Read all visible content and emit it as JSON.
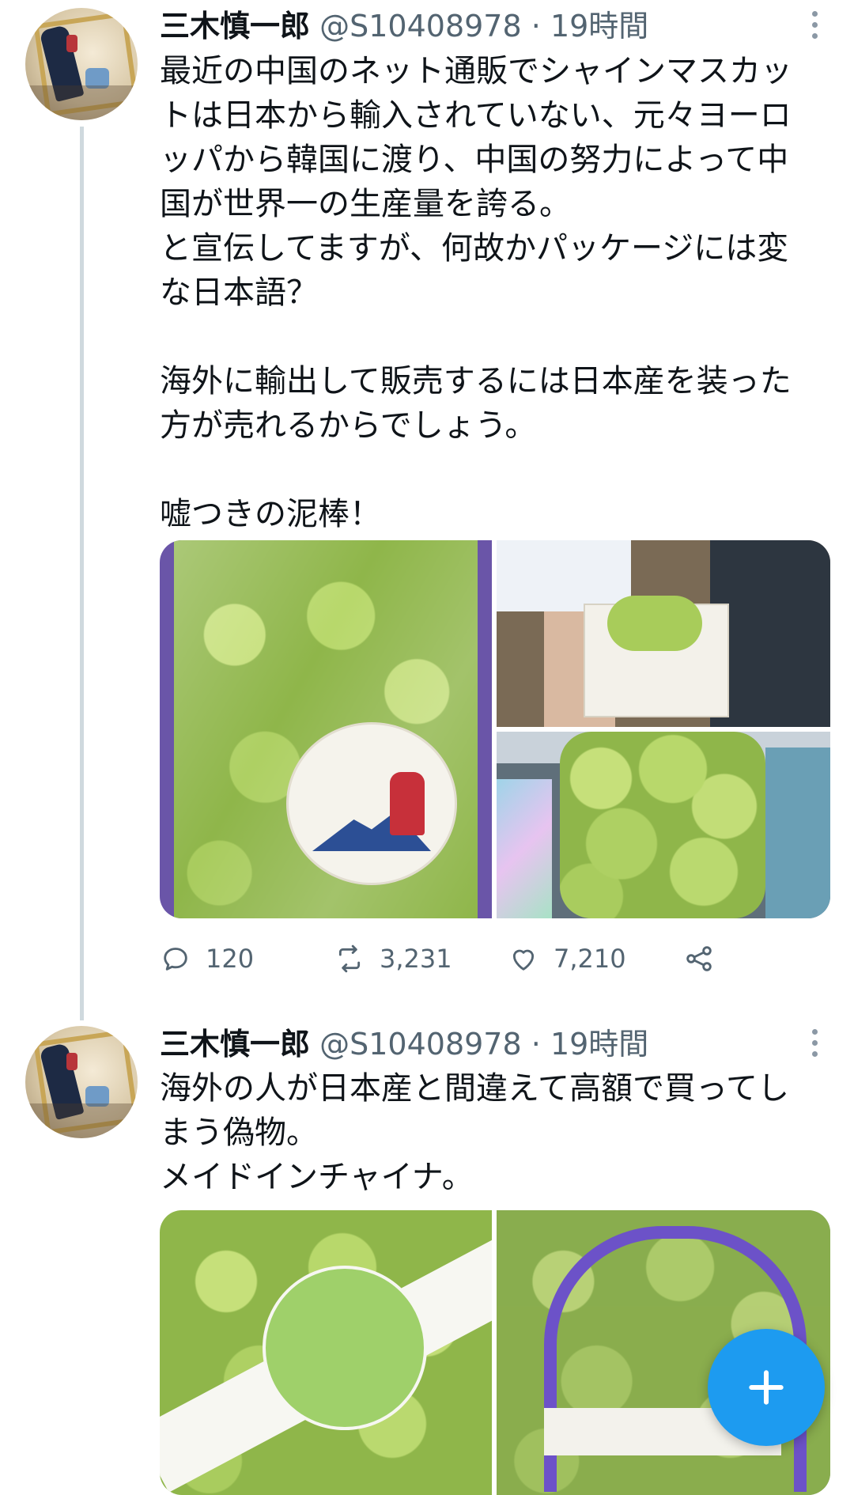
{
  "tweets": [
    {
      "author_name": "三木慎一郎",
      "handle": "@S10408978",
      "separator": "·",
      "time": "19時間",
      "text_lines": [
        "最近の中国のネット通販でシャインマスカッ",
        "トは日本から輸入されていない、元々ヨーロ",
        "ッパから韓国に渡り、中国の努力によって中",
        "国が世界一の生産量を誇る。",
        "と宣伝してますが、何故かパッケージには変",
        "な日本語？",
        "",
        "海外に輸出して販売するには日本産を装った",
        "方が売れるからでしょう。",
        "",
        "嘘つきの泥棒！"
      ],
      "replies": "120",
      "retweets": "3,231",
      "likes": "7,210"
    },
    {
      "author_name": "三木慎一郎",
      "handle": "@S10408978",
      "separator": "·",
      "time": "19時間",
      "text_lines": [
        "海外の人が日本産と間違えて高額で買ってし",
        "まう偽物。",
        "メイドインチャイナ。"
      ]
    }
  ],
  "icons": {
    "reply": "reply-icon",
    "retweet": "retweet-icon",
    "like": "heart-icon",
    "share": "share-icon",
    "more": "more-vertical-icon",
    "compose": "plus-icon"
  },
  "colors": {
    "accent": "#1d9bf0",
    "secondary_text": "#536471",
    "thread_line": "#cfd9de"
  }
}
